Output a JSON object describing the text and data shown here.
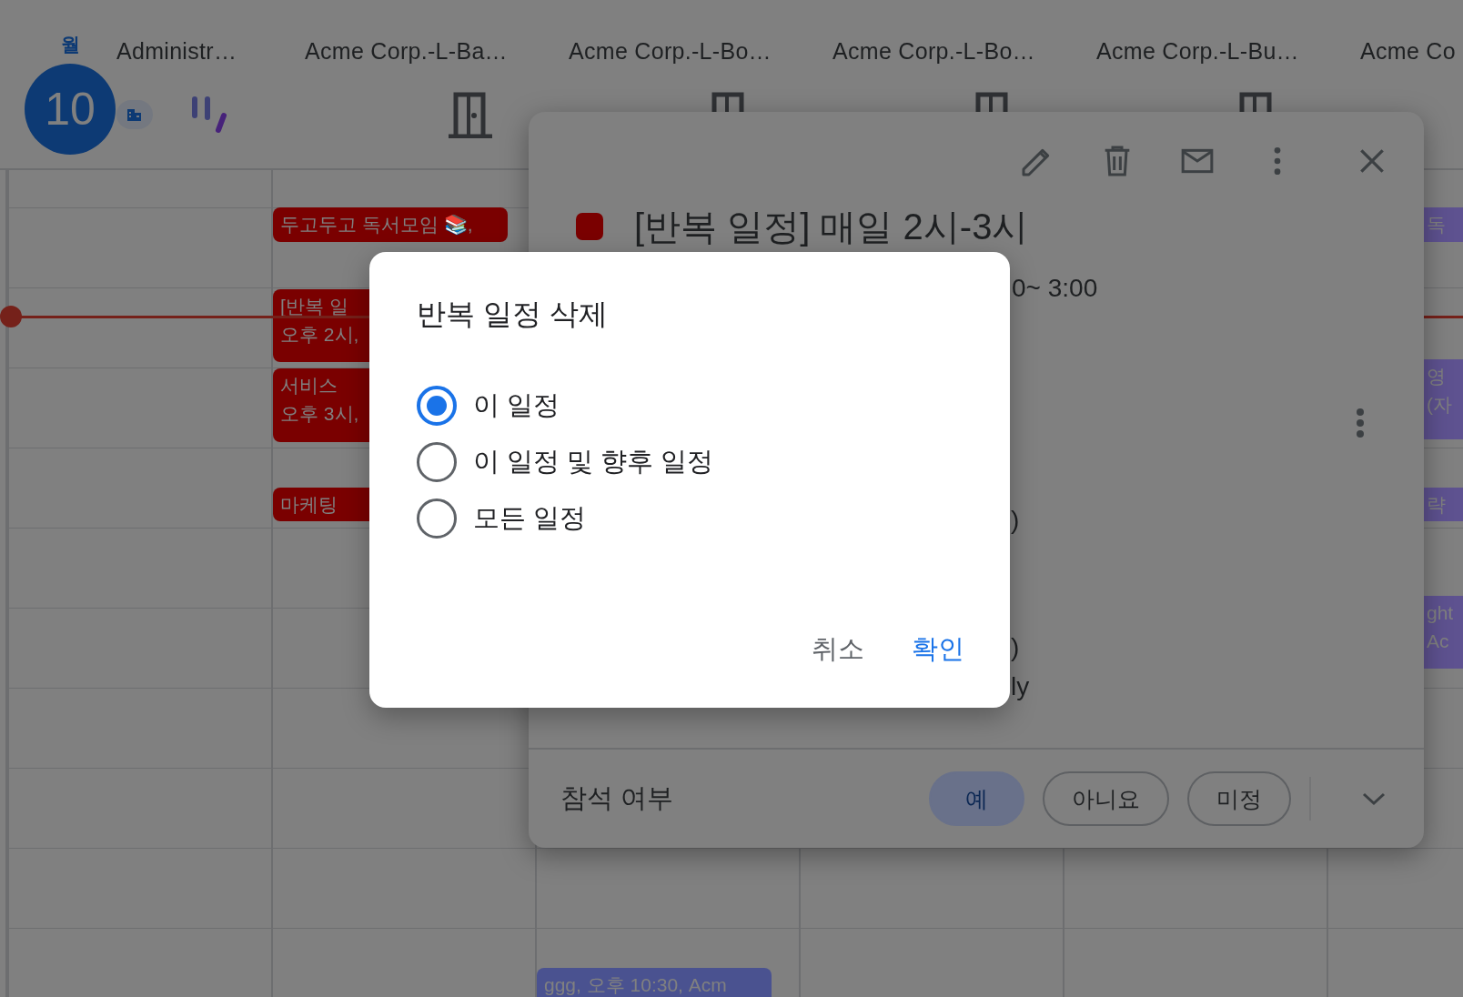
{
  "calendar": {
    "weekday": "월",
    "day": "10",
    "resources": [
      {
        "name": "Administr…"
      },
      {
        "name": "Acme Corp.-L-Ba…",
        "events": [
          {
            "lines": [
              "두고두고 독서모임 📚,"
            ],
            "color": "#7a0000"
          },
          {
            "lines": [
              "[반복 일",
              "오후 2시,"
            ],
            "color": "#7a0000"
          },
          {
            "lines": [
              "서비스",
              "오후 3시,"
            ],
            "color": "#7a0000"
          },
          {
            "lines": [
              "마케팅"
            ],
            "color": "#7a0000"
          }
        ]
      },
      {
        "name": "Acme Corp.-L-Bo…",
        "events": [
          {
            "lines": [
              "ggg, 오후 10:30, Acm"
            ],
            "color": "#4a5290"
          }
        ]
      },
      {
        "name": "Acme Corp.-L-Bo…"
      },
      {
        "name": "Acme Corp.-L-Bu…"
      },
      {
        "name": "Acme Co",
        "events": [
          {
            "lines": [
              "독"
            ],
            "color": "#5e5290"
          },
          {
            "lines": [
              "영",
              "(자"
            ],
            "color": "#5e5290"
          },
          {
            "lines": [
              "략"
            ],
            "color": "#5e5290"
          },
          {
            "lines": [
              "ght",
              "Ac"
            ],
            "color": "#5e5290"
          }
        ]
      }
    ]
  },
  "event_popover": {
    "title": "[반복 일정] 매일 2시-3시",
    "time": "0~ 3:00",
    "detail_fragments": [
      ")",
      ")",
      "ly"
    ],
    "attendance": {
      "label": "참석 여부",
      "options": [
        {
          "label": "예",
          "selected": true
        },
        {
          "label": "아니요",
          "selected": false
        },
        {
          "label": "미정",
          "selected": false
        }
      ]
    }
  },
  "dialog": {
    "title": "반복 일정 삭제",
    "options": [
      {
        "label": "이 일정",
        "selected": true
      },
      {
        "label": "이 일정 및 향후 일정",
        "selected": false
      },
      {
        "label": "모든 일정",
        "selected": false
      }
    ],
    "buttons": [
      {
        "label": "취소",
        "kind": "cancel"
      },
      {
        "label": "확인",
        "kind": "confirm"
      }
    ]
  }
}
